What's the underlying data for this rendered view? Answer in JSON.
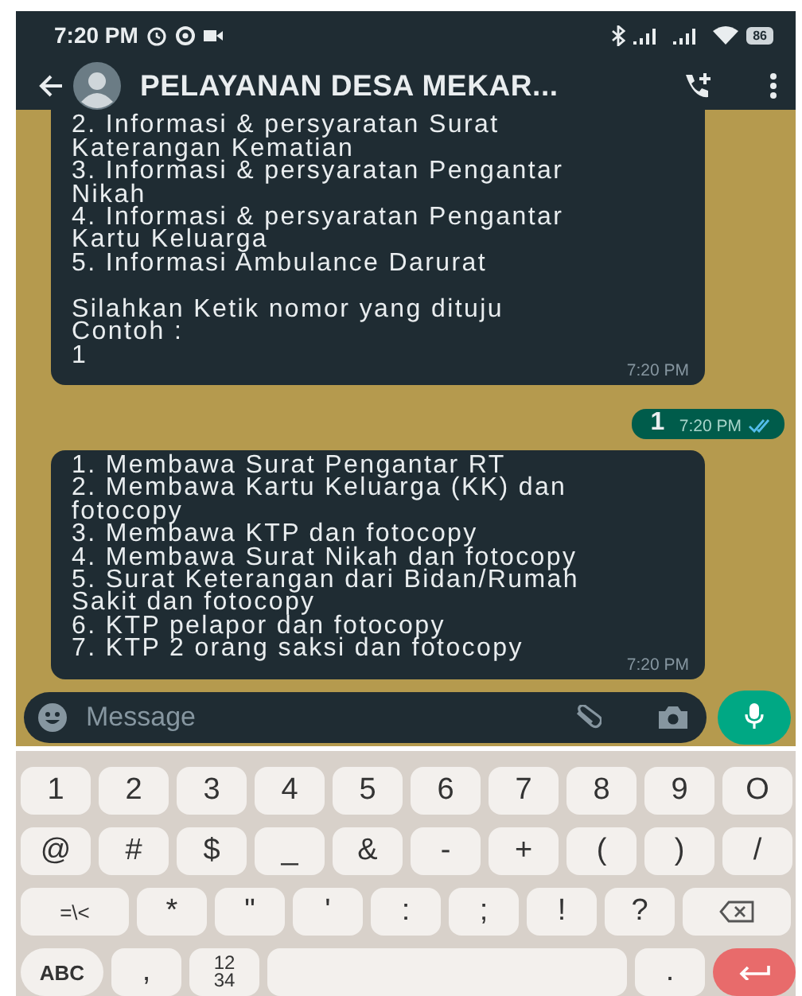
{
  "status_bar": {
    "time": "7:20 PM",
    "battery": "86"
  },
  "header": {
    "title": "PELAYANAN DESA MEKAR..."
  },
  "messages": [
    {
      "kind": "incoming",
      "text": "2. Informasi & persyaratan Surat\nKaterangan Kematian\n3. Informasi & persyaratan Pengantar\nNikah\n4. Informasi & persyaratan Pengantar\nKartu Keluarga\n5. Informasi Ambulance Darurat\n\nSilahkan Ketik nomor yang dituju\nContoh :\n1",
      "time": "7:20 PM"
    },
    {
      "kind": "outgoing",
      "text": "1",
      "time": "7:20 PM",
      "read": true
    },
    {
      "kind": "incoming",
      "text": "1. Membawa Surat Pengantar RT\n2. Membawa Kartu Keluarga (KK) dan\nfotocopy\n3. Membawa KTP dan fotocopy\n4. Membawa Surat Nikah dan fotocopy\n5. Surat Keterangan dari Bidan/Rumah\nSakit dan fotocopy\n6. KTP pelapor dan fotocopy\n7. KTP 2 orang saksi dan fotocopy",
      "time": "7:20 PM"
    }
  ],
  "composer": {
    "placeholder": "Message"
  },
  "keyboard": {
    "rows": [
      [
        {
          "kind": "char",
          "label": "1"
        },
        {
          "kind": "char",
          "label": "2"
        },
        {
          "kind": "char",
          "label": "3"
        },
        {
          "kind": "char",
          "label": "4"
        },
        {
          "kind": "char",
          "label": "5"
        },
        {
          "kind": "char",
          "label": "6"
        },
        {
          "kind": "char",
          "label": "7"
        },
        {
          "kind": "char",
          "label": "8"
        },
        {
          "kind": "char",
          "label": "9"
        },
        {
          "kind": "char",
          "label": "O"
        }
      ],
      [
        {
          "kind": "char",
          "label": "@"
        },
        {
          "kind": "char",
          "label": "#"
        },
        {
          "kind": "char",
          "label": "$"
        },
        {
          "kind": "char",
          "label": "_"
        },
        {
          "kind": "char",
          "label": "&"
        },
        {
          "kind": "char",
          "label": "-"
        },
        {
          "kind": "char",
          "label": "+"
        },
        {
          "kind": "char",
          "label": "("
        },
        {
          "kind": "char",
          "label": ")"
        },
        {
          "kind": "char",
          "label": "/"
        }
      ],
      [
        {
          "kind": "wide",
          "label": "=\\<"
        },
        {
          "kind": "char",
          "label": "*"
        },
        {
          "kind": "char",
          "label": "\""
        },
        {
          "kind": "char",
          "label": "'"
        },
        {
          "kind": "char",
          "label": ":"
        },
        {
          "kind": "char",
          "label": ";"
        },
        {
          "kind": "char",
          "label": "!"
        },
        {
          "kind": "char",
          "label": "?"
        },
        {
          "kind": "backspace"
        }
      ],
      [
        {
          "kind": "wide",
          "label": "ABC"
        },
        {
          "kind": "char",
          "label": ","
        },
        {
          "kind": "stack",
          "lines": [
            "12",
            "34"
          ]
        },
        {
          "kind": "space"
        },
        {
          "kind": "char",
          "label": "."
        },
        {
          "kind": "enter"
        }
      ]
    ]
  }
}
